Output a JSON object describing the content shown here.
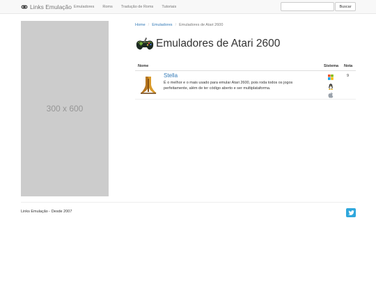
{
  "nav": {
    "brand": "Links Emulação",
    "links": [
      "Emuladores",
      "Roms",
      "Tradução de Roms",
      "Tutoriais"
    ],
    "search_placeholder": "",
    "search_button": "Buscar"
  },
  "ad": {
    "label": "300 x 600"
  },
  "breadcrumb": {
    "home": "Home",
    "section": "Emuladores",
    "current": "Emuladores de Atari 2600"
  },
  "page": {
    "title": "Emuladores de Atari 2600"
  },
  "table": {
    "headers": {
      "name": "Nome",
      "system": "Sistema",
      "score": "Nota"
    },
    "rows": [
      {
        "name": "Stella",
        "description": "É o melhor e o mais usado para emular Atari 2600, pois roda todos os jogos perfeitamente, além de ter código aberto e ser multiplataforma.",
        "systems": [
          "windows-icon",
          "linux-icon",
          "apple-icon"
        ],
        "score": "9"
      }
    ]
  },
  "footer": {
    "text": "Links Emulação - Desde 2007"
  }
}
